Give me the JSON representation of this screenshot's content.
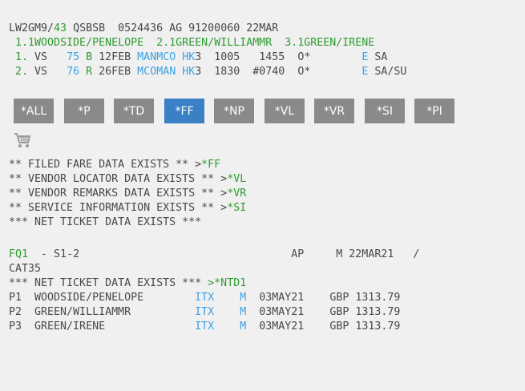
{
  "header_lines": [
    [
      {
        "t": "LW2GM9/",
        "c": ""
      },
      {
        "t": "43",
        "c": "g"
      },
      {
        "t": " QSBSB  0524436 AG 91200060 22MAR",
        "c": ""
      }
    ],
    [
      {
        "t": " 1.1WOODSIDE/PENELOPE  2.1GREEN/WILLIAMMR  3.1GREEN/IRENE",
        "c": "g"
      }
    ],
    [
      {
        "t": " 1.",
        "c": "g"
      },
      {
        "t": " VS   ",
        "c": ""
      },
      {
        "t": "75",
        "c": "b"
      },
      {
        "t": " ",
        "c": ""
      },
      {
        "t": "B",
        "c": "g"
      },
      {
        "t": " 12FEB ",
        "c": ""
      },
      {
        "t": "MANMCO HK",
        "c": "b"
      },
      {
        "t": "3  1005   1455  O*        ",
        "c": ""
      },
      {
        "t": "E",
        "c": "b"
      },
      {
        "t": " SA",
        "c": ""
      }
    ],
    [
      {
        "t": " 2.",
        "c": "g"
      },
      {
        "t": " VS   ",
        "c": ""
      },
      {
        "t": "76",
        "c": "b"
      },
      {
        "t": " ",
        "c": ""
      },
      {
        "t": "R",
        "c": "g"
      },
      {
        "t": " 26FEB ",
        "c": ""
      },
      {
        "t": "MCOMAN HK",
        "c": "b"
      },
      {
        "t": "3  1830  #0740  O*        ",
        "c": ""
      },
      {
        "t": "E",
        "c": "b"
      },
      {
        "t": " SA/SU",
        "c": ""
      }
    ]
  ],
  "buttons": [
    {
      "label": "*ALL",
      "active": false
    },
    {
      "label": "*P",
      "active": false
    },
    {
      "label": "*TD",
      "active": false
    },
    {
      "label": "*FF",
      "active": true
    },
    {
      "label": "*NP",
      "active": false
    },
    {
      "label": "*VL",
      "active": false
    },
    {
      "label": "*VR",
      "active": false
    },
    {
      "label": "*SI",
      "active": false
    },
    {
      "label": "*PI",
      "active": false
    }
  ],
  "cart_icon": "shopping-cart-icon",
  "notice_lines": [
    [
      {
        "t": "** FILED FARE DATA EXISTS ** >",
        "c": ""
      },
      {
        "t": "*FF",
        "c": "g",
        "link": true
      }
    ],
    [
      {
        "t": "** VENDOR LOCATOR DATA EXISTS ** >",
        "c": ""
      },
      {
        "t": "*VL",
        "c": "g",
        "link": true
      }
    ],
    [
      {
        "t": "** VENDOR REMARKS DATA EXISTS ** >",
        "c": ""
      },
      {
        "t": "*VR",
        "c": "g",
        "link": true
      }
    ],
    [
      {
        "t": "** SERVICE INFORMATION EXISTS ** >",
        "c": ""
      },
      {
        "t": "*SI",
        "c": "g",
        "link": true
      }
    ],
    [
      {
        "t": "*** NET TICKET DATA EXISTS ***",
        "c": ""
      }
    ]
  ],
  "fare_lines": [
    [
      {
        "t": "FQ1",
        "c": "g",
        "link": true
      },
      {
        "t": "  - S1-2                                 AP     M 22MAR21   /",
        "c": ""
      }
    ],
    [
      {
        "t": "CAT35",
        "c": ""
      }
    ],
    [
      {
        "t": "*** NET TICKET DATA EXISTS *** ",
        "c": ""
      },
      {
        "t": ">*NTD1",
        "c": "g",
        "link": true
      }
    ],
    [
      {
        "t": "P1  WOODSIDE/PENELOPE        ",
        "c": ""
      },
      {
        "t": "ITX",
        "c": "b"
      },
      {
        "t": "    ",
        "c": ""
      },
      {
        "t": "M",
        "c": "b"
      },
      {
        "t": "  03MAY21    GBP 1313.79",
        "c": ""
      }
    ],
    [
      {
        "t": "P2  GREEN/WILLIAMMR          ",
        "c": ""
      },
      {
        "t": "ITX",
        "c": "b"
      },
      {
        "t": "    ",
        "c": ""
      },
      {
        "t": "M",
        "c": "b"
      },
      {
        "t": "  03MAY21    GBP 1313.79",
        "c": ""
      }
    ],
    [
      {
        "t": "P3  GREEN/IRENE              ",
        "c": ""
      },
      {
        "t": "ITX",
        "c": "b"
      },
      {
        "t": "    ",
        "c": ""
      },
      {
        "t": "M",
        "c": "b"
      },
      {
        "t": "  03MAY21    GBP 1313.79",
        "c": ""
      }
    ]
  ],
  "colors": {
    "green": "#2f9b2f",
    "blue": "#3ba2e3",
    "button": "#8a8a8a",
    "button_active": "#3a80c4"
  }
}
